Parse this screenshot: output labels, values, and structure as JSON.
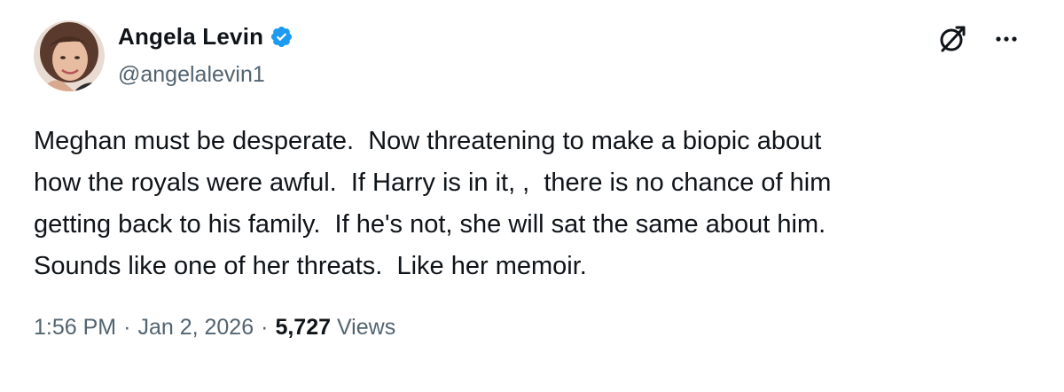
{
  "author": {
    "display_name": "Angela Levin",
    "handle": "@angelalevin1",
    "verified": true,
    "avatar_icon": "profile-photo",
    "verified_icon": "verified-badge-icon"
  },
  "actions": {
    "grok_icon": "grok-icon",
    "more_icon": "more-options-icon"
  },
  "tweet": {
    "lines": [
      "Meghan must be desperate.  Now threatening to make a biopic about",
      "how the royals were awful.  If Harry is in it, ,  there is no chance of him",
      "getting back to his family.  If he's not, she will sat the same about him.",
      "Sounds like one of her threats.  Like her memoir."
    ]
  },
  "meta": {
    "time": "1:56 PM",
    "separator": "·",
    "date": "Jan 2, 2026",
    "views_count": "5,727",
    "views_label": "Views"
  },
  "colors": {
    "text_primary": "#0f1419",
    "text_secondary": "#536471",
    "verified_blue": "#1d9bf0",
    "background": "#ffffff"
  }
}
